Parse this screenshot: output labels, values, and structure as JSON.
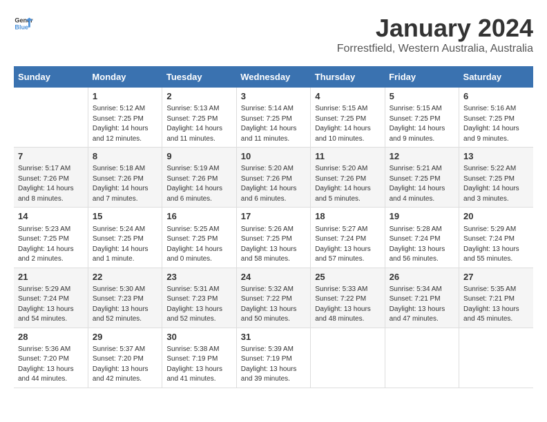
{
  "header": {
    "logo_line1": "General",
    "logo_line2": "Blue",
    "month_title": "January 2024",
    "location": "Forrestfield, Western Australia, Australia"
  },
  "weekdays": [
    "Sunday",
    "Monday",
    "Tuesday",
    "Wednesday",
    "Thursday",
    "Friday",
    "Saturday"
  ],
  "weeks": [
    [
      {
        "day": "",
        "info": ""
      },
      {
        "day": "1",
        "info": "Sunrise: 5:12 AM\nSunset: 7:25 PM\nDaylight: 14 hours\nand 12 minutes."
      },
      {
        "day": "2",
        "info": "Sunrise: 5:13 AM\nSunset: 7:25 PM\nDaylight: 14 hours\nand 11 minutes."
      },
      {
        "day": "3",
        "info": "Sunrise: 5:14 AM\nSunset: 7:25 PM\nDaylight: 14 hours\nand 11 minutes."
      },
      {
        "day": "4",
        "info": "Sunrise: 5:15 AM\nSunset: 7:25 PM\nDaylight: 14 hours\nand 10 minutes."
      },
      {
        "day": "5",
        "info": "Sunrise: 5:15 AM\nSunset: 7:25 PM\nDaylight: 14 hours\nand 9 minutes."
      },
      {
        "day": "6",
        "info": "Sunrise: 5:16 AM\nSunset: 7:25 PM\nDaylight: 14 hours\nand 9 minutes."
      }
    ],
    [
      {
        "day": "7",
        "info": "Sunrise: 5:17 AM\nSunset: 7:26 PM\nDaylight: 14 hours\nand 8 minutes."
      },
      {
        "day": "8",
        "info": "Sunrise: 5:18 AM\nSunset: 7:26 PM\nDaylight: 14 hours\nand 7 minutes."
      },
      {
        "day": "9",
        "info": "Sunrise: 5:19 AM\nSunset: 7:26 PM\nDaylight: 14 hours\nand 6 minutes."
      },
      {
        "day": "10",
        "info": "Sunrise: 5:20 AM\nSunset: 7:26 PM\nDaylight: 14 hours\nand 6 minutes."
      },
      {
        "day": "11",
        "info": "Sunrise: 5:20 AM\nSunset: 7:26 PM\nDaylight: 14 hours\nand 5 minutes."
      },
      {
        "day": "12",
        "info": "Sunrise: 5:21 AM\nSunset: 7:25 PM\nDaylight: 14 hours\nand 4 minutes."
      },
      {
        "day": "13",
        "info": "Sunrise: 5:22 AM\nSunset: 7:25 PM\nDaylight: 14 hours\nand 3 minutes."
      }
    ],
    [
      {
        "day": "14",
        "info": "Sunrise: 5:23 AM\nSunset: 7:25 PM\nDaylight: 14 hours\nand 2 minutes."
      },
      {
        "day": "15",
        "info": "Sunrise: 5:24 AM\nSunset: 7:25 PM\nDaylight: 14 hours\nand 1 minute."
      },
      {
        "day": "16",
        "info": "Sunrise: 5:25 AM\nSunset: 7:25 PM\nDaylight: 14 hours\nand 0 minutes."
      },
      {
        "day": "17",
        "info": "Sunrise: 5:26 AM\nSunset: 7:25 PM\nDaylight: 13 hours\nand 58 minutes."
      },
      {
        "day": "18",
        "info": "Sunrise: 5:27 AM\nSunset: 7:24 PM\nDaylight: 13 hours\nand 57 minutes."
      },
      {
        "day": "19",
        "info": "Sunrise: 5:28 AM\nSunset: 7:24 PM\nDaylight: 13 hours\nand 56 minutes."
      },
      {
        "day": "20",
        "info": "Sunrise: 5:29 AM\nSunset: 7:24 PM\nDaylight: 13 hours\nand 55 minutes."
      }
    ],
    [
      {
        "day": "21",
        "info": "Sunrise: 5:29 AM\nSunset: 7:24 PM\nDaylight: 13 hours\nand 54 minutes."
      },
      {
        "day": "22",
        "info": "Sunrise: 5:30 AM\nSunset: 7:23 PM\nDaylight: 13 hours\nand 52 minutes."
      },
      {
        "day": "23",
        "info": "Sunrise: 5:31 AM\nSunset: 7:23 PM\nDaylight: 13 hours\nand 52 minutes."
      },
      {
        "day": "24",
        "info": "Sunrise: 5:32 AM\nSunset: 7:22 PM\nDaylight: 13 hours\nand 50 minutes."
      },
      {
        "day": "25",
        "info": "Sunrise: 5:33 AM\nSunset: 7:22 PM\nDaylight: 13 hours\nand 48 minutes."
      },
      {
        "day": "26",
        "info": "Sunrise: 5:34 AM\nSunset: 7:21 PM\nDaylight: 13 hours\nand 47 minutes."
      },
      {
        "day": "27",
        "info": "Sunrise: 5:35 AM\nSunset: 7:21 PM\nDaylight: 13 hours\nand 45 minutes."
      }
    ],
    [
      {
        "day": "28",
        "info": "Sunrise: 5:36 AM\nSunset: 7:20 PM\nDaylight: 13 hours\nand 44 minutes."
      },
      {
        "day": "29",
        "info": "Sunrise: 5:37 AM\nSunset: 7:20 PM\nDaylight: 13 hours\nand 42 minutes."
      },
      {
        "day": "30",
        "info": "Sunrise: 5:38 AM\nSunset: 7:19 PM\nDaylight: 13 hours\nand 41 minutes."
      },
      {
        "day": "31",
        "info": "Sunrise: 5:39 AM\nSunset: 7:19 PM\nDaylight: 13 hours\nand 39 minutes."
      },
      {
        "day": "",
        "info": ""
      },
      {
        "day": "",
        "info": ""
      },
      {
        "day": "",
        "info": ""
      }
    ]
  ]
}
